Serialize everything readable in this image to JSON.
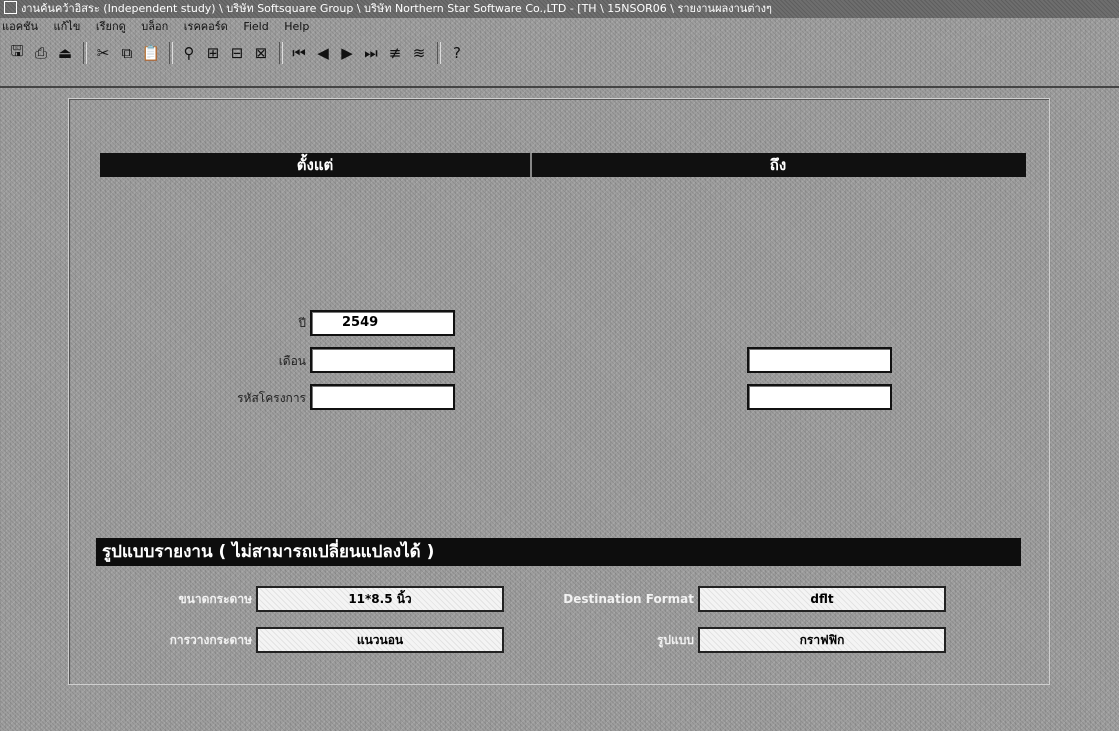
{
  "window": {
    "title": "งานค้นคว้าอิสระ (Independent study) \\ บริษัท Softsquare Group \\ บริษัท Northern Star Software Co.,LTD - [TH \\ 15NSOR06 \\ รายงานผลงานต่างๆ"
  },
  "menubar": {
    "items": [
      "แอคชัน",
      "แก้ไข",
      "เรียกดู",
      "บล็อก",
      "เรคคอร์ด",
      "Field",
      "Help"
    ]
  },
  "toolbar": {
    "buttons": [
      {
        "icon": "save-icon",
        "glyph": "🖫"
      },
      {
        "icon": "print-icon",
        "glyph": "⎙"
      },
      {
        "icon": "exit-icon",
        "glyph": "⏏"
      },
      {
        "icon": "cut-icon",
        "glyph": "✂"
      },
      {
        "icon": "copy-icon",
        "glyph": "⧉"
      },
      {
        "icon": "paste-icon",
        "glyph": "📋"
      },
      {
        "icon": "query-icon",
        "glyph": "⚲"
      },
      {
        "icon": "enter-query-icon",
        "glyph": "⊞"
      },
      {
        "icon": "execute-query-icon",
        "glyph": "⊟"
      },
      {
        "icon": "cancel-query-icon",
        "glyph": "⊠"
      },
      {
        "icon": "first-record-icon",
        "glyph": "⏮"
      },
      {
        "icon": "previous-record-icon",
        "glyph": "◀"
      },
      {
        "icon": "next-record-icon",
        "glyph": "▶"
      },
      {
        "icon": "last-record-icon",
        "glyph": "⏭"
      },
      {
        "icon": "insert-record-icon",
        "glyph": "≢"
      },
      {
        "icon": "delete-record-icon",
        "glyph": "≋"
      },
      {
        "icon": "help-icon",
        "glyph": "?"
      }
    ]
  },
  "criteria": {
    "from_header": "ตั้งแต่",
    "to_header": "ถึง",
    "year_label": "ปี",
    "year_value": "2549",
    "month_label": "เดือน",
    "month_from_value": "",
    "month_to_value": "",
    "project_label": "รหัสโครงการ",
    "project_from_value": "",
    "project_to_value": ""
  },
  "report_format": {
    "header": "รูปแบบรายงาน ( ไม่สามารถเปลี่ยนแปลงได้ )",
    "paper_size_label": "ขนาดกระดาษ",
    "paper_size_value": "11*8.5 นิ้ว",
    "orientation_label": "การวางกระดาษ",
    "orientation_value": "แนวนอน",
    "destination_format_label": "Destination Format",
    "destination_format_value": "dflt",
    "type_label": "รูปแบบ",
    "type_value": "กราฟฟิก"
  }
}
